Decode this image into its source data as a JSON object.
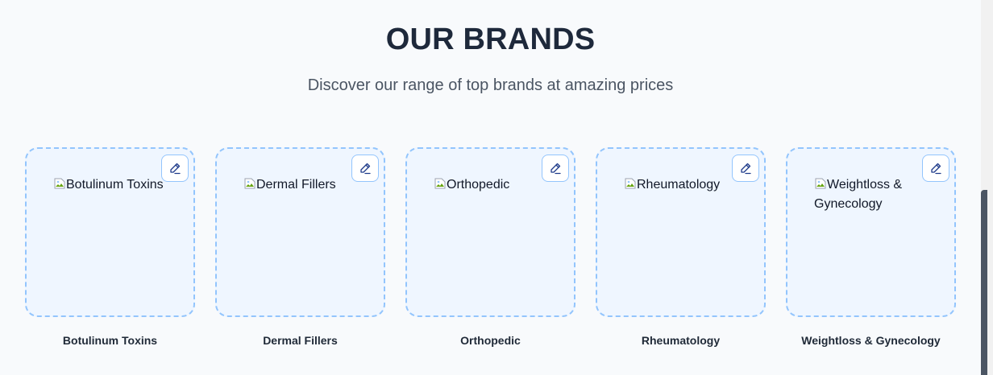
{
  "section": {
    "title": "OUR BRANDS",
    "subtitle": "Discover our range of top brands at amazing prices"
  },
  "brands": [
    {
      "name": "Botulinum Toxins",
      "image_alt": "Botulinum Toxins",
      "edit_icon": "pencil-icon"
    },
    {
      "name": "Dermal Fillers",
      "image_alt": "Dermal Fillers",
      "edit_icon": "pencil-icon"
    },
    {
      "name": "Orthopedic",
      "image_alt": "Orthopedic",
      "edit_icon": "pencil-icon"
    },
    {
      "name": "Rheumatology",
      "image_alt": "Rheumatology",
      "edit_icon": "pencil-icon"
    },
    {
      "name": "Weightloss & Gynecology",
      "image_alt": "Weightloss & Gynecology",
      "edit_icon": "pencil-icon"
    }
  ],
  "colors": {
    "background": "#f8fafc",
    "card_border": "#93c5fd",
    "card_fill": "#eff6ff",
    "title": "#1e293b",
    "subtitle": "#4b5563",
    "edit_icon": "#1e3a8a"
  }
}
